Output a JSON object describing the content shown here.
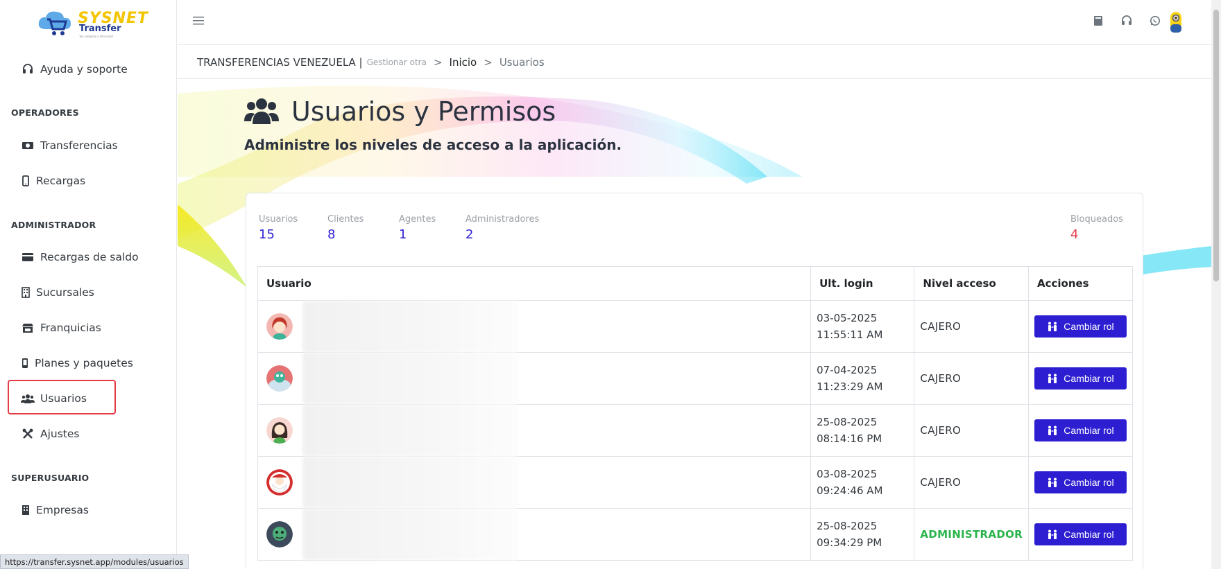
{
  "sidebar": {
    "logo": {
      "brand": "SYSNET",
      "product": "Transfer",
      "tagline": "Tus compras a otro nivel"
    },
    "support": "Ayuda y soporte",
    "sections": {
      "operadores": "OPERADORES",
      "administrador": "ADMINISTRADOR",
      "superusuario": "SUPERUSUARIO"
    },
    "items": {
      "transferencias": "Transferencias",
      "recargas": "Recargas",
      "recargas_saldo": "Recargas de saldo",
      "sucursales": "Sucursales",
      "franquicias": "Franquicias",
      "planes": "Planes y paquetes",
      "usuarios": "Usuarios",
      "ajustes": "Ajustes",
      "empresas": "Empresas"
    }
  },
  "breadcrumb": {
    "company": "TRANSFERENCIAS VENEZUELA |",
    "manage": "Gestionar otra",
    "sep": ">",
    "home": "Inicio",
    "current": "Usuarios"
  },
  "page": {
    "title": "Usuarios y Permisos",
    "subtitle": "Administre los niveles de acceso a la aplicación."
  },
  "stats": [
    {
      "label": "Usuarios",
      "value": "15"
    },
    {
      "label": "Clientes",
      "value": "8"
    },
    {
      "label": "Agentes",
      "value": "1"
    },
    {
      "label": "Administradores",
      "value": "2"
    },
    {
      "label": "Bloqueados",
      "value": "4"
    }
  ],
  "table": {
    "headers": {
      "user": "Usuario",
      "login": "Ult. login",
      "level": "Nivel acceso",
      "actions": "Acciones"
    },
    "rows": [
      {
        "date": "03-05-2025",
        "time": "11:55:11 AM",
        "role": "CAJERO",
        "action": "Cambiar rol"
      },
      {
        "date": "07-04-2025",
        "time": "11:23:29 AM",
        "role": "CAJERO",
        "action": "Cambiar rol"
      },
      {
        "date": "25-08-2025",
        "time": "08:14:16 PM",
        "role": "CAJERO",
        "action": "Cambiar rol"
      },
      {
        "date": "03-08-2025",
        "time": "09:24:46 AM",
        "role": "CAJERO",
        "action": "Cambiar rol"
      },
      {
        "date": "25-08-2025",
        "time": "09:34:29 PM",
        "role": "ADMINISTRADOR",
        "action": "Cambiar rol"
      }
    ]
  },
  "status_url": "https://transfer.sysnet.app/modules/usuarios",
  "colors": {
    "accent": "#2d1fd1",
    "danger": "#e53946",
    "success": "#28b44a",
    "highlight": "#e53946"
  }
}
